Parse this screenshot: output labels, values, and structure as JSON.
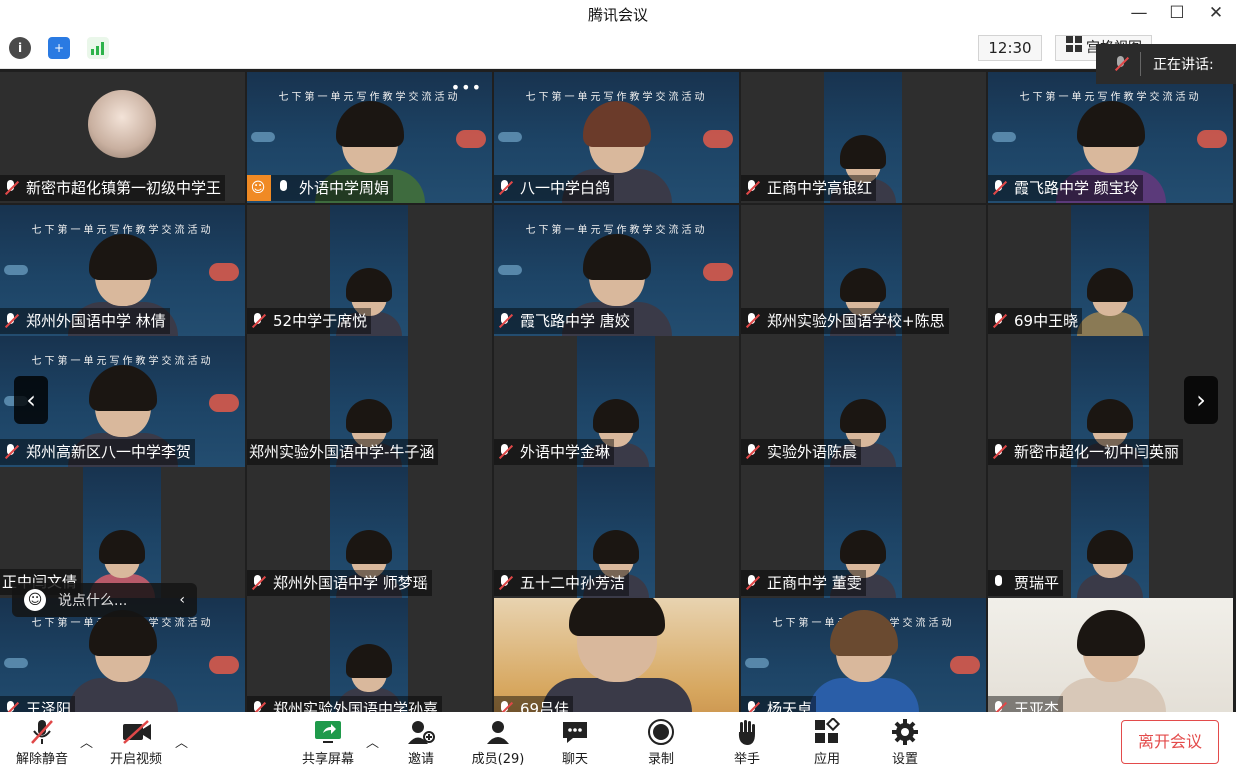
{
  "window": {
    "title": "腾讯会议",
    "minimize": "—",
    "maximize": "☐",
    "close": "✕"
  },
  "toolbar": {
    "time": "12:30",
    "layout_label": "宫格视图"
  },
  "speaking": {
    "label": "正在讲话:"
  },
  "participants": [
    {
      "name": "新密市超化镇第一初级中学王",
      "muted": true
    },
    {
      "name": "外语中学周娟",
      "muted": false,
      "host": true
    },
    {
      "name": "八一中学白鸽",
      "muted": true
    },
    {
      "name": "正商中学高银红",
      "muted": true
    },
    {
      "name": "霞飞路中学 颜宝玲",
      "muted": true
    },
    {
      "name": "郑州外国语中学  林倩",
      "muted": true
    },
    {
      "name": "52中学于席悦",
      "muted": true
    },
    {
      "name": "霞飞路中学 唐姣",
      "muted": true
    },
    {
      "name": "郑州实验外国语学校+陈思",
      "muted": true
    },
    {
      "name": "69中王晓",
      "muted": true
    },
    {
      "name": "郑州高新区八一中学李贺",
      "muted": true
    },
    {
      "name": "郑州实验外国语中学-牛子涵",
      "muted": true
    },
    {
      "name": "外语中学金琳",
      "muted": true
    },
    {
      "name": "实验外语陈晨",
      "muted": true
    },
    {
      "name": "新密市超化一初中闫英丽",
      "muted": true
    },
    {
      "name": "正中闫文倩",
      "muted": true
    },
    {
      "name": "郑州外国语中学 师梦瑶",
      "muted": true
    },
    {
      "name": "五十二中孙芳洁",
      "muted": true
    },
    {
      "name": "正商中学  董雯",
      "muted": true
    },
    {
      "name": "贾瑞平",
      "muted": false
    },
    {
      "name": "王泽阳",
      "muted": true
    },
    {
      "name": "郑州实验外国语中学孙嘉",
      "muted": true
    },
    {
      "name": "69吕佳",
      "muted": true
    },
    {
      "name": "杨天卓",
      "muted": true
    },
    {
      "name": "王亚杰",
      "muted": true
    }
  ],
  "slide_text": "七下第一单元写作教学交流活动",
  "chat": {
    "placeholder": "说点什么...",
    "emoji_icon": "smiley-icon"
  },
  "bottom": {
    "unmute": "解除静音",
    "video": "开启视频",
    "share": "共享屏幕",
    "invite": "邀请",
    "members": "成员(29)",
    "chat": "聊天",
    "record": "录制",
    "hand": "举手",
    "apps": "应用",
    "settings": "设置",
    "leave": "离开会议"
  },
  "colors": {
    "accent_orange": "#f08a24",
    "leave_red": "#e34b4b",
    "mute_red": "#e04848"
  }
}
